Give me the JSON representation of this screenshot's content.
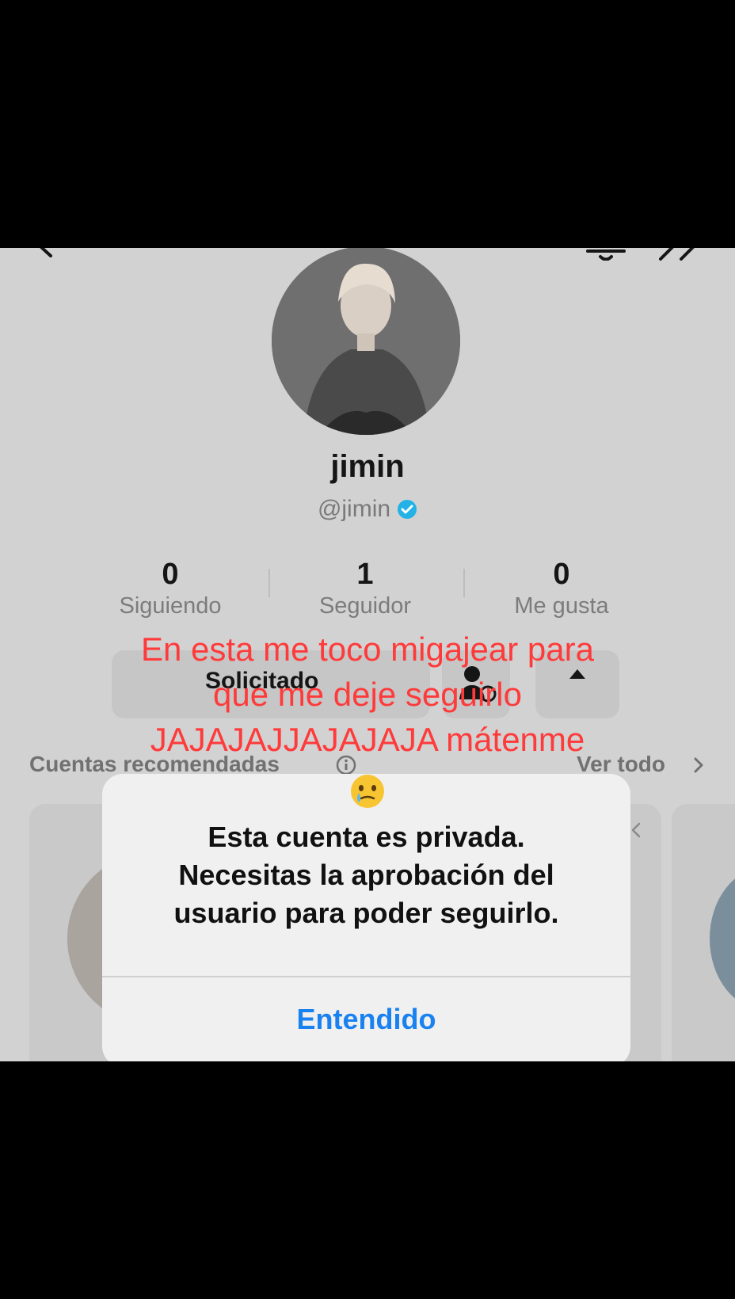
{
  "profile": {
    "name": "jimin",
    "handle": "@jimin",
    "verified": true
  },
  "stats": [
    {
      "value": "0",
      "label": "Siguiendo"
    },
    {
      "value": "1",
      "label": "Seguidor"
    },
    {
      "value": "0",
      "label": "Me gusta"
    }
  ],
  "actions": {
    "follow_status_label": "Solicitado"
  },
  "caption": {
    "text": "En esta me toco migajear para\nque me deje seguirlo\nJAJAJAJJAJAJAJA mátenme"
  },
  "recommended": {
    "title": "Cuentas recomendadas",
    "see_all": "Ver todo"
  },
  "dialog": {
    "message": "Esta cuenta es privada.\nNecesitas la aprobación del\nusuario para poder seguirlo.",
    "confirm_label": "Entendido"
  },
  "colors": {
    "caption_red": "#ff3a3a",
    "link_blue": "#1a82f0",
    "verified_blue": "#22b2e6",
    "background_gray": "#d2d2d2"
  }
}
